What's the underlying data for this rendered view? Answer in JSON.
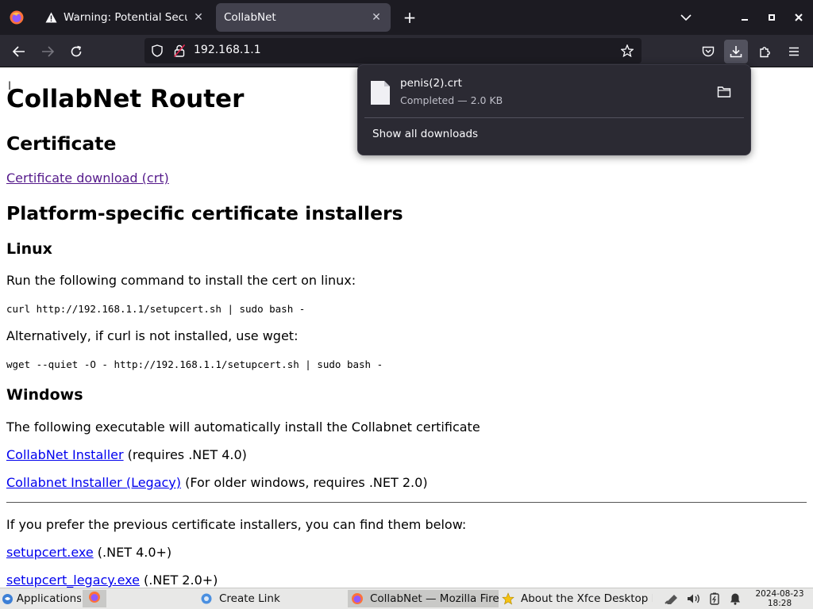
{
  "browser": {
    "tabs": [
      {
        "title": "Warning: Potential Security Risk Ahead",
        "active": false
      },
      {
        "title": "CollabNet",
        "active": true
      }
    ],
    "url": "192.168.1.1"
  },
  "downloads": {
    "filename": "penis(2).crt",
    "status": "Completed — 2.0 KB",
    "show_all": "Show all downloads"
  },
  "page": {
    "title": "CollabNet Router",
    "cert_heading": "Certificate",
    "cert_link": "Certificate download (crt)",
    "installers_heading": "Platform-specific certificate installers",
    "linux": {
      "heading": "Linux",
      "intro": "Run the following command to install the cert on linux:",
      "cmd_curl": "curl http://192.168.1.1/setupcert.sh | sudo bash -",
      "alt": "Alternatively, if curl is not installed, use wget:",
      "cmd_wget": "wget --quiet -O - http://192.168.1.1/setupcert.sh | sudo bash -"
    },
    "windows": {
      "heading": "Windows",
      "intro": "The following executable will automatically install the Collabnet certificate",
      "link1": "CollabNet Installer",
      "note1": " (requires .NET 4.0)",
      "link2": "Collabnet Installer (Legacy)",
      "note2": " (For older windows, requires .NET 2.0)"
    },
    "previous": {
      "intro": "If you prefer the previous certificate installers, you can find them below:",
      "link1": "setupcert.exe",
      "note1": " (.NET 4.0+)",
      "link2": "setupcert_legacy.exe",
      "note2": " (.NET 2.0+)"
    }
  },
  "taskbar": {
    "applications": "Applications",
    "windows": [
      {
        "title": "Create Link"
      },
      {
        "title": "CollabNet — Mozilla Firefox"
      },
      {
        "title": "About the Xfce Desktop Environment"
      }
    ],
    "date": "2024-08-23",
    "time": "18:28"
  },
  "colors": {
    "tab_strip": "#1c1b22",
    "toolbar": "#2b2a33",
    "link": "#0000ee",
    "visited_link": "#551a8b"
  }
}
